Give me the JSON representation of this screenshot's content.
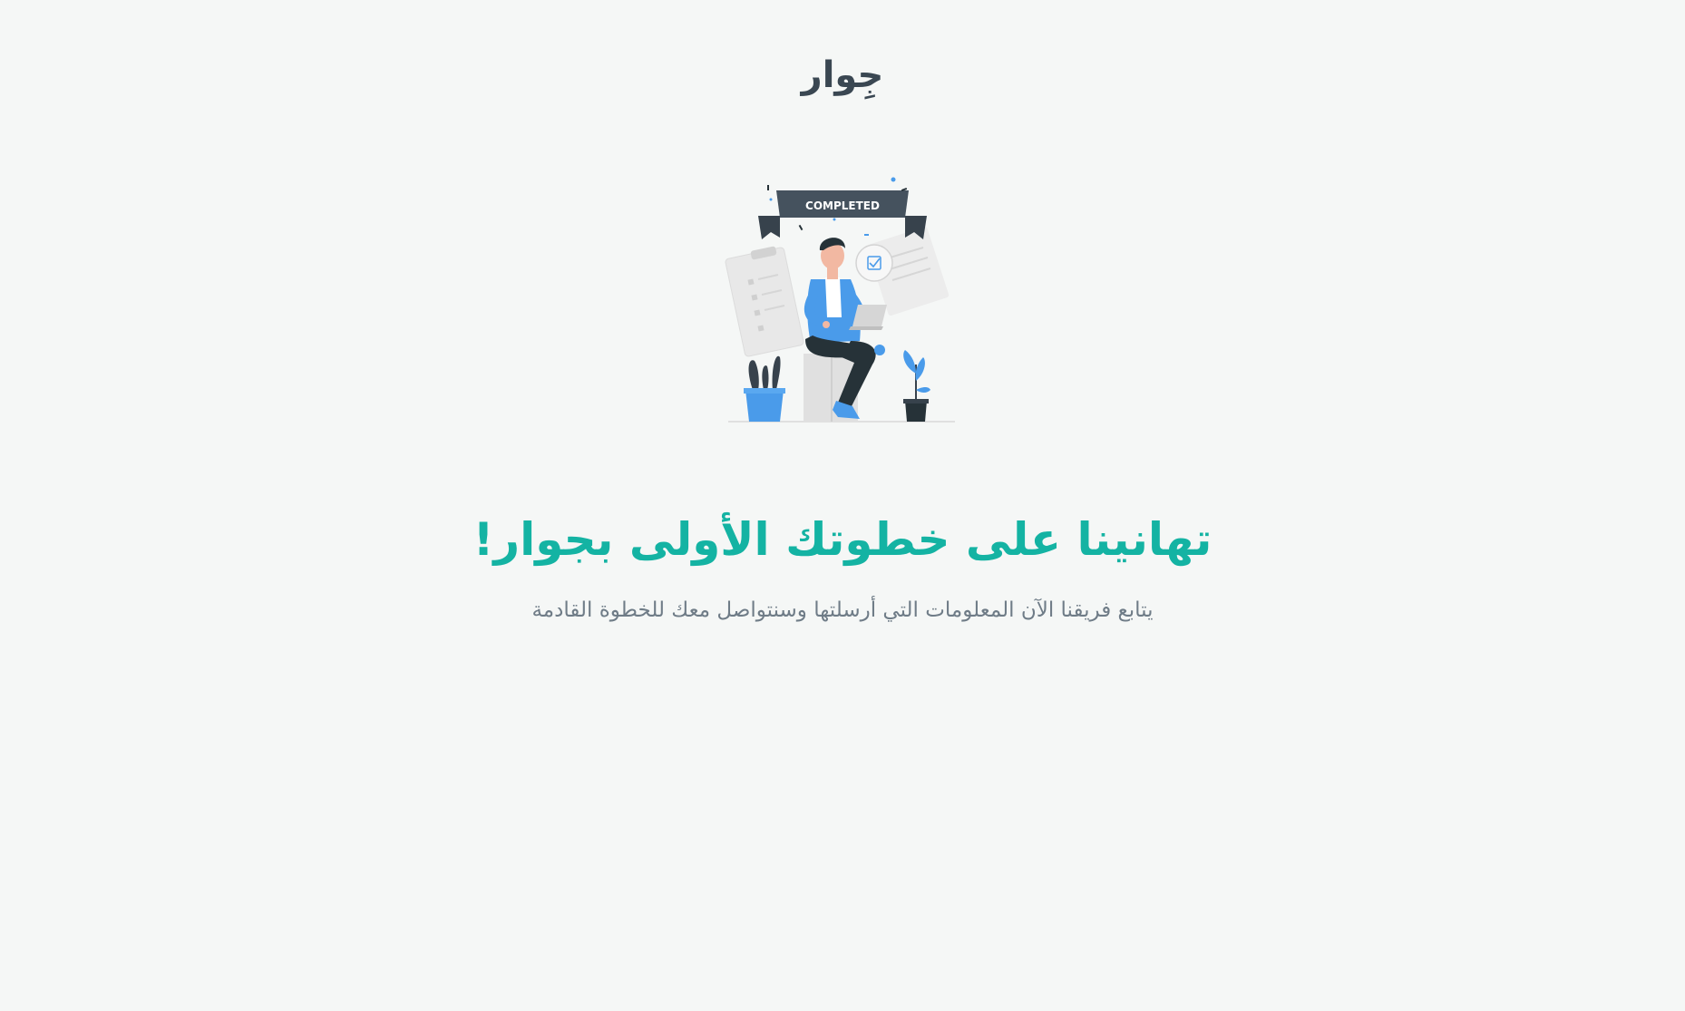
{
  "brand": {
    "logo_text": "جِوار"
  },
  "illustration": {
    "banner_label": "COMPLETED",
    "icon": "completed-illustration-icon",
    "colors": {
      "banner": "#45525e",
      "accent_blue": "#4a9bea",
      "dark": "#263238",
      "paper": "#ebebeb"
    }
  },
  "main": {
    "headline": "تهانينا على خطوتك الأولى بجوار!",
    "subtitle": "يتابع فريقنا الآن المعلومات التي أرسلتها وسنتواصل معك للخطوة القادمة"
  },
  "colors": {
    "background": "#f5f7f6",
    "headline": "#14b3a3",
    "logo": "#3a4752",
    "subtitle": "#6f7c87"
  }
}
